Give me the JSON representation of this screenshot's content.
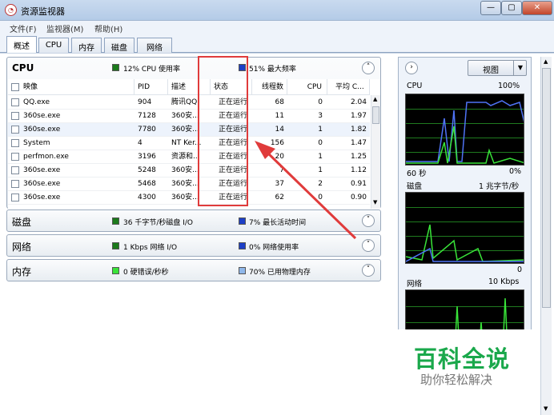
{
  "window": {
    "title": "资源监视器",
    "minimize": "—",
    "maximize": "▢",
    "close": "✕"
  },
  "menu": [
    {
      "label": "文件(F)"
    },
    {
      "label": "监视器(M)"
    },
    {
      "label": "帮助(H)"
    }
  ],
  "tabs": [
    {
      "label": "概述"
    },
    {
      "label": "CPU"
    },
    {
      "label": "内存"
    },
    {
      "label": "磁盘"
    },
    {
      "label": "网络"
    }
  ],
  "cpu": {
    "title": "CPU",
    "usage": "12% CPU 使用率",
    "freq": "51% 最大频率",
    "collapse_icon": "˄",
    "columns": {
      "image": "映像",
      "pid": "PID",
      "desc": "描述",
      "status": "状态",
      "threads": "线程数",
      "cpu": "CPU",
      "avg": "平均 C..."
    },
    "rows": [
      {
        "image": "QQ.exe",
        "pid": "904",
        "desc": "腾讯QQ",
        "status": "正在运行",
        "threads": "68",
        "cpu": "0",
        "avg": "2.04"
      },
      {
        "image": "360se.exe",
        "pid": "7128",
        "desc": "360安...",
        "status": "正在运行",
        "threads": "11",
        "cpu": "3",
        "avg": "1.97"
      },
      {
        "image": "360se.exe",
        "pid": "7780",
        "desc": "360安...",
        "status": "正在运行",
        "threads": "14",
        "cpu": "1",
        "avg": "1.82"
      },
      {
        "image": "System",
        "pid": "4",
        "desc": "NT Ker...",
        "status": "正在运行",
        "threads": "156",
        "cpu": "0",
        "avg": "1.47"
      },
      {
        "image": "perfmon.exe",
        "pid": "3196",
        "desc": "资源和...",
        "status": "正在运行",
        "threads": "20",
        "cpu": "1",
        "avg": "1.25"
      },
      {
        "image": "360se.exe",
        "pid": "5248",
        "desc": "360安...",
        "status": "正在运行",
        "threads": "7",
        "cpu": "1",
        "avg": "1.12"
      },
      {
        "image": "360se.exe",
        "pid": "5468",
        "desc": "360安...",
        "status": "正在运行",
        "threads": "37",
        "cpu": "2",
        "avg": "0.91"
      },
      {
        "image": "360se.exe",
        "pid": "4300",
        "desc": "360安...",
        "status": "正在运行",
        "threads": "62",
        "cpu": "0",
        "avg": "0.90"
      }
    ]
  },
  "disk": {
    "title": "磁盘",
    "io": "36 千字节/秒磁盘 I/O",
    "active": "7% 最长活动时间"
  },
  "network": {
    "title": "网络",
    "io": "1 Kbps 网络 I/O",
    "usage": "0% 网络使用率"
  },
  "memory": {
    "title": "内存",
    "faults": "0 硬错误/秒秒",
    "used": "70% 已用物理内存"
  },
  "right_panel": {
    "view_label": "视图",
    "cpu_graph": {
      "label": "CPU",
      "max": "100%",
      "duration": "60 秒",
      "min": "0%"
    },
    "disk_graph": {
      "label": "磁盘",
      "max": "1 兆字节/秒",
      "min": "0"
    },
    "net_graph": {
      "label": "网络",
      "max": "10 Kbps"
    }
  },
  "watermark": {
    "title": "百科全说",
    "subtitle": "助你轻松解决"
  },
  "colors": {
    "accent_green": "#1aa84b",
    "annotation_red": "#e03b3b",
    "graph_green": "#39e339",
    "graph_blue": "#4f73f5"
  }
}
